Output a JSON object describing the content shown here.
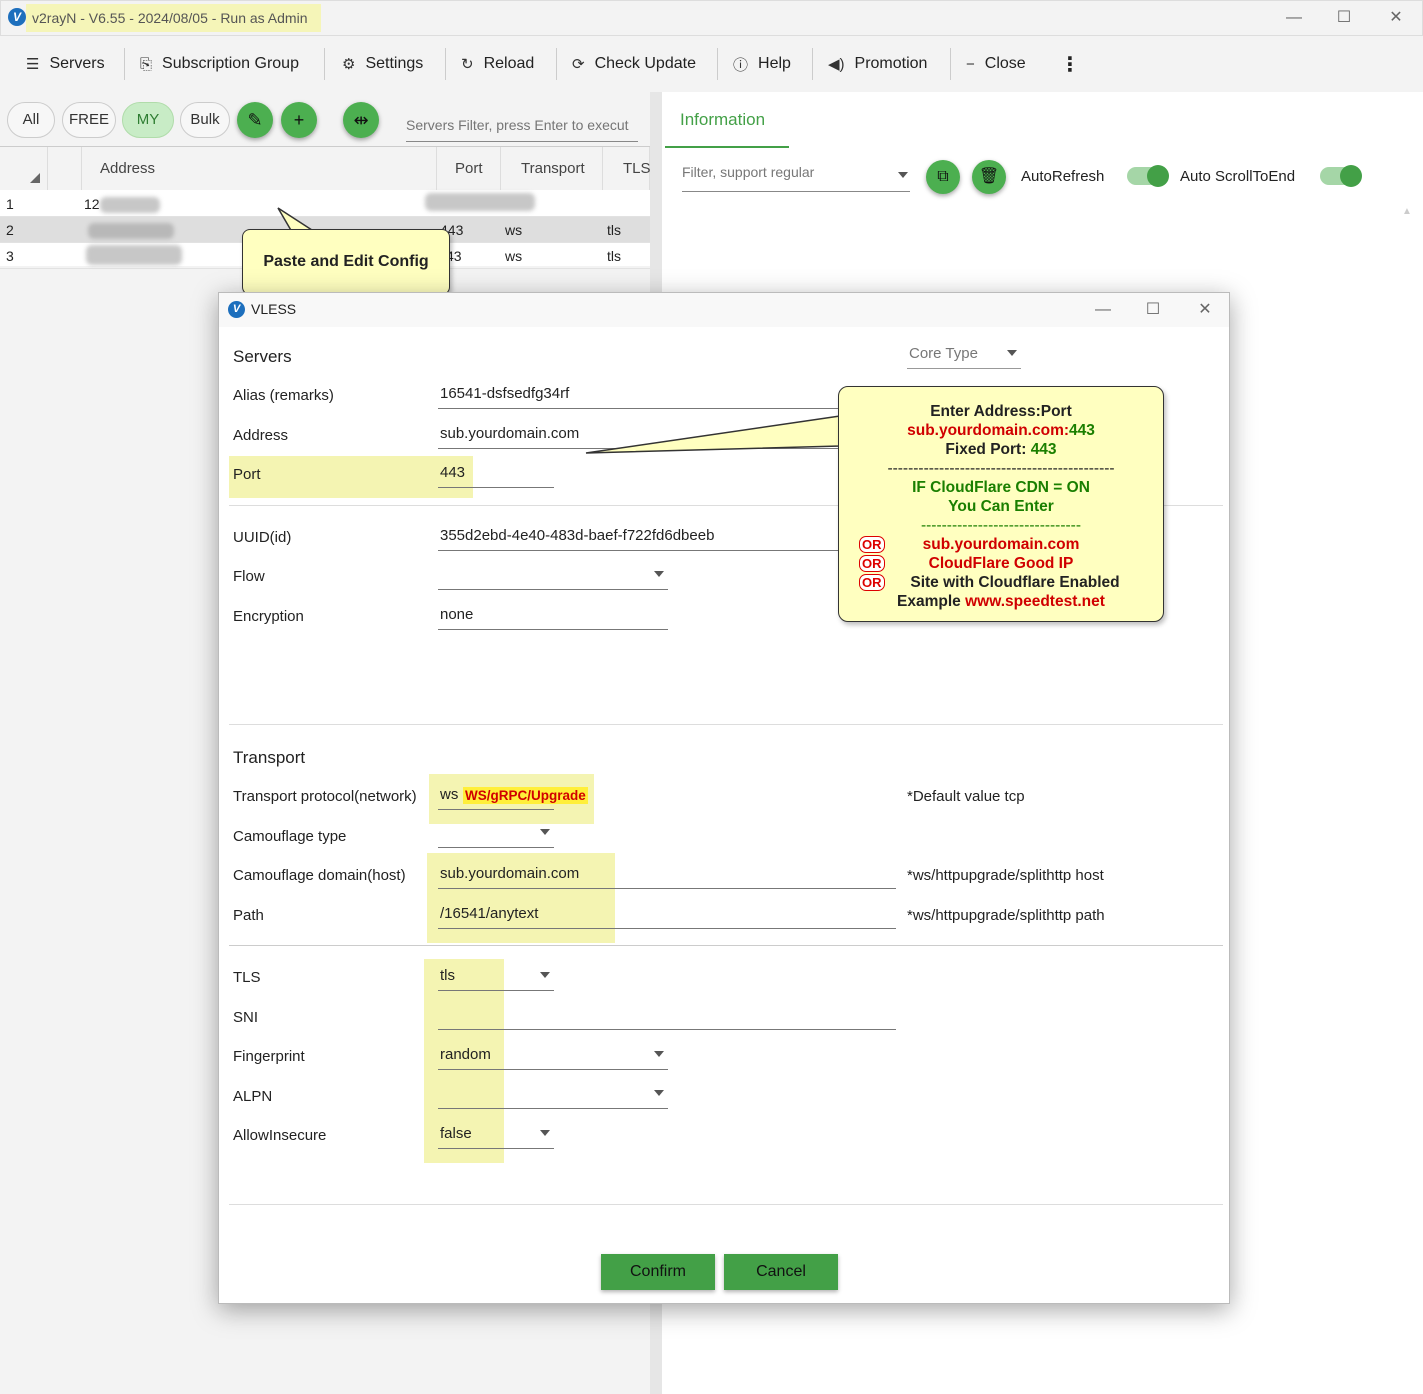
{
  "app": {
    "title": "v2rayN - V6.55 - 2024/08/05 - Run as Admin",
    "logo_letter": "V",
    "window_controls": {
      "minimize": "—",
      "maximize": "☐",
      "close": "✕"
    }
  },
  "menu": {
    "items": [
      {
        "label": "Servers",
        "icon": "server-icon"
      },
      {
        "label": "Subscription Group",
        "icon": "subscription-icon"
      },
      {
        "label": "Settings",
        "icon": "gear-icon"
      },
      {
        "label": "Reload",
        "icon": "reload-icon"
      },
      {
        "label": "Check Update",
        "icon": "update-icon"
      },
      {
        "label": "Help",
        "icon": "help-icon"
      },
      {
        "label": "Promotion",
        "icon": "speaker-icon"
      },
      {
        "label": "Close",
        "icon": "minus-icon"
      }
    ],
    "more": "⋮"
  },
  "filters": {
    "chips": [
      "All",
      "FREE",
      "MY",
      "Bulk"
    ],
    "active_chip": "MY",
    "servers_filter_placeholder": "Servers Filter, press Enter to execut"
  },
  "grid": {
    "columns": [
      "Address",
      "Port",
      "Transport",
      "TLS"
    ],
    "rows": [
      {
        "index": "1",
        "address": "12",
        "port": "",
        "transport": "",
        "tls": ""
      },
      {
        "index": "2",
        "address": "",
        "port": "443",
        "transport": "ws",
        "tls": "tls"
      },
      {
        "index": "3",
        "address": "",
        "port": "43",
        "transport": "ws",
        "tls": "tls"
      }
    ]
  },
  "info_panel": {
    "tab": "Information",
    "filter_placeholder": "Filter, support regular",
    "auto_refresh": "AutoRefresh",
    "auto_scroll": "Auto ScrollToEnd",
    "auto_refresh_on": true,
    "auto_scroll_on": true
  },
  "callout_paste": "Paste and Edit Config",
  "dialog": {
    "title": "VLESS",
    "servers_section": "Servers",
    "core_type": "Core Type",
    "alias_label": "Alias (remarks)",
    "alias_value": "16541-dsfsedfg34rf",
    "address_label": "Address",
    "address_value": "sub.yourdomain.com",
    "port_label": "Port",
    "port_value": "443",
    "uuid_label": "UUID(id)",
    "uuid_value": "355d2ebd-4e40-483d-baef-f722fd6dbeeb",
    "flow_label": "Flow",
    "flow_value": "",
    "encryption_label": "Encryption",
    "encryption_value": "none",
    "transport_section": "Transport",
    "network_label": "Transport protocol(network)",
    "network_value": "ws",
    "network_annotation": "WS/gRPC/Upgrade",
    "network_hint": "*Default value tcp",
    "camouflage_type_label": "Camouflage type",
    "camouflage_type_value": "",
    "host_label": "Camouflage domain(host)",
    "host_value": "sub.yourdomain.com",
    "host_hint": "*ws/httpupgrade/splithttp host",
    "path_label": "Path",
    "path_value": "/16541/anytext",
    "path_hint": "*ws/httpupgrade/splithttp path",
    "tls_label": "TLS",
    "tls_value": "tls",
    "sni_label": "SNI",
    "sni_value": "",
    "fingerprint_label": "Fingerprint",
    "fingerprint_value": "random",
    "alpn_label": "ALPN",
    "alpn_value": "",
    "allow_insecure_label": "AllowInsecure",
    "allow_insecure_value": "false",
    "confirm": "Confirm",
    "cancel": "Cancel"
  },
  "callout_address": {
    "line1": "Enter Address:Port",
    "line2_domain": "sub.yourdomain.com:",
    "line2_port": "443",
    "line3_label": "Fixed Port: ",
    "line3_port": "443",
    "sep1": "--------------------------------------------",
    "line4": "IF CloudFlare CDN = ON",
    "line5": "You Can Enter",
    "sep2": "-------------------------------",
    "or": "OR",
    "opt1": "sub.yourdomain.com",
    "opt2": "CloudFlare Good IP",
    "opt3": "Site with Cloudflare Enabled",
    "example_label": "Example ",
    "example_site": "www.speedtest.net"
  },
  "colors": {
    "accent_green": "#43a047",
    "highlight_yellow": "#f4f4b2",
    "callout_yellow": "#ffffc0",
    "annotation_red": "#d00000",
    "annotation_green": "#1a7f00"
  }
}
